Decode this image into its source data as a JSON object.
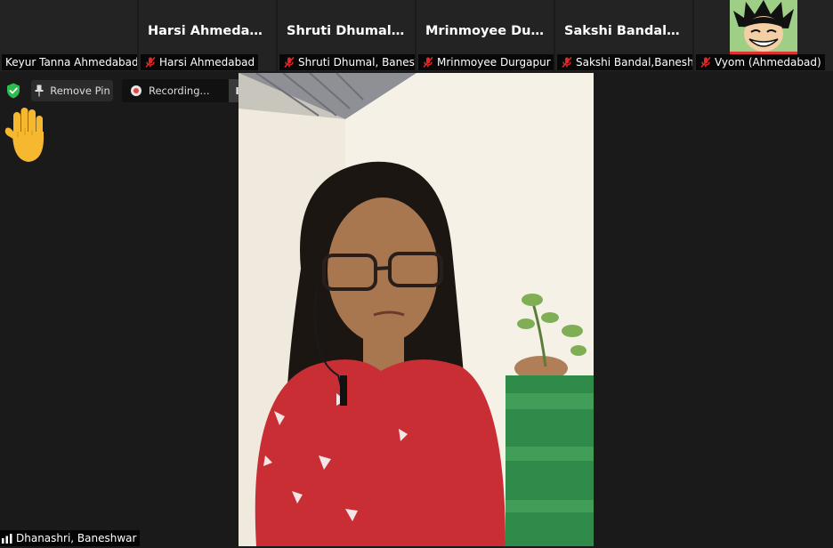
{
  "participants": [
    {
      "name_tag": "Keyur Tanna Ahmedabad",
      "big_name": "",
      "muted": false
    },
    {
      "name_tag": "Harsi Ahmedabad",
      "big_name": "Harsi Ahmedabad",
      "muted": true
    },
    {
      "name_tag": "Shruti Dhumal, Banes...",
      "big_name": "Shruti  Dhumal,...",
      "muted": true
    },
    {
      "name_tag": "Mrinmoyee Durgapur",
      "big_name": "Mrinmoyee  Dur...",
      "muted": true
    },
    {
      "name_tag": "Sakshi Bandal,Banesh",
      "big_name": "Sakshi  Bandal,B...",
      "muted": true
    },
    {
      "name_tag": "Vyom (Ahmedabad)",
      "big_name": "",
      "muted": true
    }
  ],
  "toolbar": {
    "remove_pin_label": "Remove Pin",
    "recording_label": "Recording..."
  },
  "main_video": {
    "speaker_name": "Dhanashri, Baneshwar"
  },
  "icons": {
    "security": "shield-check-icon",
    "raised_hand": "raised-hand-icon",
    "mic_muted": "mic-muted-icon",
    "signal": "signal-bars-icon"
  },
  "colors": {
    "background": "#1a1a1a",
    "tile": "#232323",
    "muted_red": "#e02828",
    "security_green": "#2dbd4e",
    "hand_yellow": "#f5b82e"
  }
}
